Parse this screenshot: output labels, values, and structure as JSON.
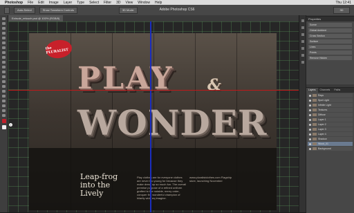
{
  "menubar": {
    "app": "Photoshop",
    "items": [
      "File",
      "Edit",
      "Image",
      "Layer",
      "Type",
      "Select",
      "Filter",
      "3D",
      "View",
      "Window",
      "Help"
    ],
    "clock": "Thu 12:41"
  },
  "window": {
    "title": "Adobe Photoshop CS6"
  },
  "optionsbar": {
    "mode": "Auto-Select",
    "group": "Show Transform Controls",
    "mode3d": "3D Mode:"
  },
  "workspace": {
    "essentials": "3D"
  },
  "doc": {
    "tab": "Extrude_retouch.psd @ 100% (RGB/8)"
  },
  "poster": {
    "logo": "the PLURALIST",
    "line1": "PLAY",
    "amp": "&",
    "line2": "WONDER",
    "tagline": [
      "Leap-frog",
      "into the",
      "Lively"
    ],
    "col1": "Play clothes are for everyone clothes are never too young for because they make dress up so much fun. The overall premise purpose of a refined uniform grafted to the notable, merry order, conquer the wonderful champion of hilarity wide eq imagine.",
    "col2": "www.pluralistclothes.com  Flagship store, launching November"
  },
  "panels": {
    "top_header": "Properties",
    "props": [
      "Scene",
      "Global Ambient",
      "Cross Section",
      "Surface",
      "Lines",
      "Points",
      "Remove Hidden"
    ],
    "tabs": [
      "Layers",
      "Channels",
      "Paths"
    ],
    "layers": [
      "Rays",
      "Spot Light",
      "Infinite Light",
      "Textures",
      "Diffuse",
      "Layer 1",
      "Layer 2",
      "Layer 3",
      "Layer 4",
      "Shadow",
      "Wood_01",
      "Background"
    ]
  }
}
